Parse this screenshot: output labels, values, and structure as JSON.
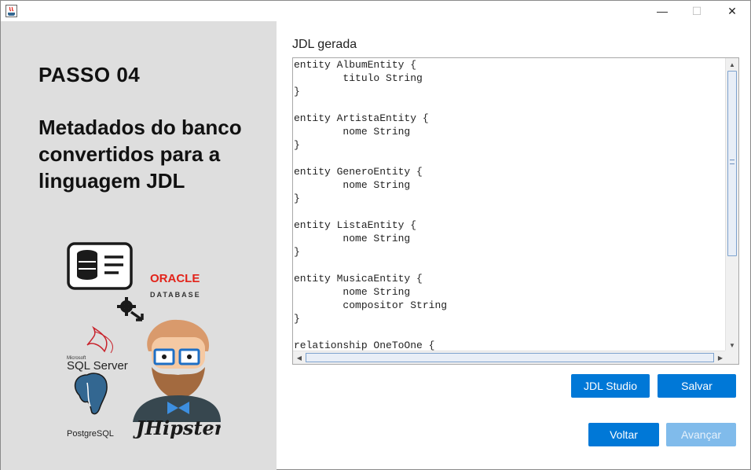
{
  "window": {
    "app_icon": "java-icon",
    "controls": {
      "minimize": "—",
      "maximize": "☐",
      "close": "✕"
    }
  },
  "left_panel": {
    "step_title": "PASSO 04",
    "description": "Metadados do banco convertidos para a linguagem JDL",
    "logos": {
      "oracle_line1": "ORACLE",
      "oracle_line2": "DATABASE",
      "sqlserver_small": "Microsoft",
      "sqlserver": "SQL Server",
      "postgres": "PostgreSQL",
      "jhipster": "JHipster"
    }
  },
  "editor": {
    "label": "JDL gerada",
    "code": "entity AlbumEntity {\n\ttitulo String\n}\n\nentity ArtistaEntity {\n\tnome String\n}\n\nentity GeneroEntity {\n\tnome String\n}\n\nentity ListaEntity {\n\tnome String\n}\n\nentity MusicaEntity {\n\tnome String\n\tcompositor String\n}\n\nrelationship OneToOne {"
  },
  "buttons": {
    "jdl_studio": "JDL Studio",
    "salvar": "Salvar",
    "voltar": "Voltar",
    "avancar": "Avançar"
  },
  "colors": {
    "primary_button": "#0078d7",
    "disabled_button": "#80bbeb",
    "left_panel_bg": "#dedede",
    "oracle_red": "#e2231a",
    "postgres_blue": "#336791"
  }
}
